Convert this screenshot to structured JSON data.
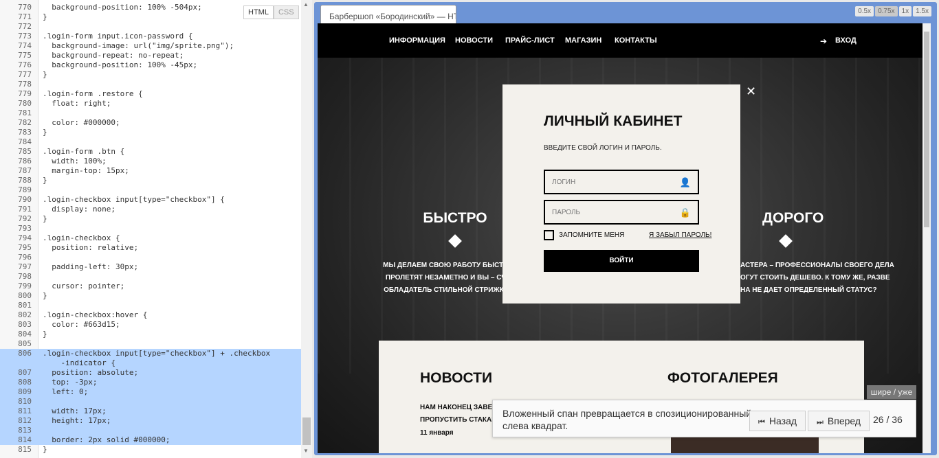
{
  "editor": {
    "mode_html": "HTML",
    "mode_css": "CSS",
    "lines": [
      {
        "n": "770",
        "text": "  background-position: 100% -504px;"
      },
      {
        "n": "771",
        "text": "}"
      },
      {
        "n": "772",
        "text": ""
      },
      {
        "n": "773",
        "text": ".login-form input.icon-password {"
      },
      {
        "n": "774",
        "text": "  background-image: url(\"img/sprite.png\");"
      },
      {
        "n": "775",
        "text": "  background-repeat: no-repeat;"
      },
      {
        "n": "776",
        "text": "  background-position: 100% -45px;"
      },
      {
        "n": "777",
        "text": "}"
      },
      {
        "n": "778",
        "text": ""
      },
      {
        "n": "779",
        "text": ".login-form .restore {"
      },
      {
        "n": "780",
        "text": "  float: right;"
      },
      {
        "n": "781",
        "text": ""
      },
      {
        "n": "782",
        "text": "  color: #000000;"
      },
      {
        "n": "783",
        "text": "}"
      },
      {
        "n": "784",
        "text": ""
      },
      {
        "n": "785",
        "text": ".login-form .btn {"
      },
      {
        "n": "786",
        "text": "  width: 100%;"
      },
      {
        "n": "787",
        "text": "  margin-top: 15px;"
      },
      {
        "n": "788",
        "text": "}"
      },
      {
        "n": "789",
        "text": ""
      },
      {
        "n": "790",
        "text": ".login-checkbox input[type=\"checkbox\"] {"
      },
      {
        "n": "791",
        "text": "  display: none;"
      },
      {
        "n": "792",
        "text": "}"
      },
      {
        "n": "793",
        "text": ""
      },
      {
        "n": "794",
        "text": ".login-checkbox {"
      },
      {
        "n": "795",
        "text": "  position: relative;"
      },
      {
        "n": "796",
        "text": ""
      },
      {
        "n": "797",
        "text": "  padding-left: 30px;"
      },
      {
        "n": "798",
        "text": ""
      },
      {
        "n": "799",
        "text": "  cursor: pointer;"
      },
      {
        "n": "800",
        "text": "}"
      },
      {
        "n": "801",
        "text": ""
      },
      {
        "n": "802",
        "text": ".login-checkbox:hover {"
      },
      {
        "n": "803",
        "text": "  color: #663d15;"
      },
      {
        "n": "804",
        "text": "}"
      },
      {
        "n": "805",
        "text": ""
      },
      {
        "n": "806",
        "text": ".login-checkbox input[type=\"checkbox\"] + .checkbox\n    -indicator {",
        "hl": true,
        "wrap": true
      },
      {
        "n": "807",
        "text": "  position: absolute;",
        "hl": true
      },
      {
        "n": "808",
        "text": "  top: -3px;",
        "hl": true
      },
      {
        "n": "809",
        "text": "  left: 0;",
        "hl": true
      },
      {
        "n": "810",
        "text": "",
        "hl": true
      },
      {
        "n": "811",
        "text": "  width: 17px;",
        "hl": true
      },
      {
        "n": "812",
        "text": "  height: 17px;",
        "hl": true
      },
      {
        "n": "813",
        "text": "",
        "hl": true
      },
      {
        "n": "814",
        "text": "  border: 2px solid #000000;",
        "hl": true
      },
      {
        "n": "815",
        "text": "}",
        "hl": false
      }
    ]
  },
  "preview": {
    "tab_title": "Барбершоп «Бородинский» — HTML",
    "zoom_levels": [
      "0.5x",
      "0.75x",
      "1x",
      "1.5x"
    ],
    "active_zoom": "0.75x"
  },
  "site": {
    "nav": [
      "ИНФОРМАЦИЯ",
      "НОВОСТИ",
      "ПРАЙС-ЛИСТ",
      "МАГАЗИН",
      "КОНТАКТЫ"
    ],
    "login_link": "ВХОД",
    "feature_fast": {
      "title": "БЫСТРО",
      "text": [
        "МЫ ДЕЛАЕМ СВОЮ РАБОТУ БЫСТРО! ДВ",
        "ПРОЛЕТЯТ НЕЗАМЕТНО И ВЫ – СЧАСТЛ",
        "ОБЛАДАТЕЛЬ СТИЛЬНОЙ СТРИЖКИ-МИН"
      ]
    },
    "feature_expensive": {
      "title": "ДОРОГО",
      "text": [
        "АСТЕРА – ПРОФЕССИОНАЛЫ СВОЕГО ДЕЛА",
        "ОГУТ СТОИТЬ ДЕШЕВО. К ТОМУ ЖЕ, РАЗВЕ",
        "НА НЕ ДАЕТ ОПРЕДЕЛЕННЫЙ СТАТУС?"
      ]
    },
    "modal": {
      "title": "ЛИЧНЫЙ КАБИНЕТ",
      "subtitle": "ВВЕДИТЕ СВОЙ ЛОГИН И ПАРОЛЬ.",
      "login_placeholder": "ЛОГИН",
      "password_placeholder": "ПАРОЛЬ",
      "remember": "ЗАПОМНИТЕ МЕНЯ",
      "forgot": "Я ЗАБЫЛ ПАРОЛЬ!",
      "submit": "ВОЙТИ",
      "close": "✕"
    },
    "news": {
      "title": "НОВОСТИ",
      "item_line1": "НАМ НАКОНЕЦ ЗАВЕЗЛИ Я",
      "item_line2": "ПРОПУСТИТЬ СТАКАНЧИК",
      "date": "11 января"
    },
    "gallery": {
      "title": "ФОТОГАЛЕРЕЯ"
    }
  },
  "tour": {
    "wide_toggle": "шире / уже",
    "text_line1": "Вложенный спан превращается в спозиционированный",
    "text_line2": "слева квадрат.",
    "back": "Назад",
    "forward": "Вперед",
    "counter": "26 / 36"
  }
}
